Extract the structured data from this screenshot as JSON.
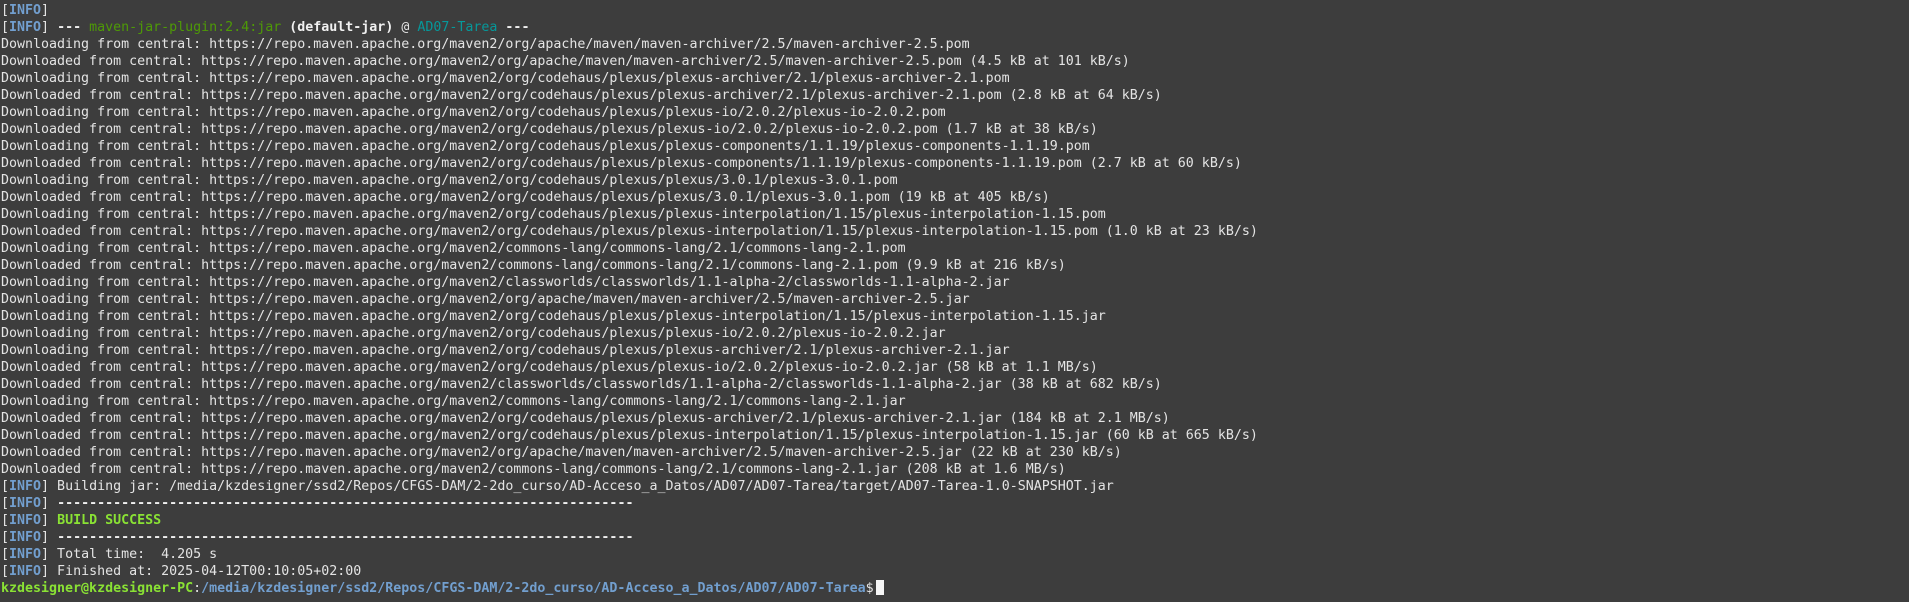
{
  "terminal": {
    "lines": [
      [
        {
          "t": "[",
          "c": ""
        },
        {
          "t": "INFO",
          "c": "info"
        },
        {
          "t": "]",
          "c": ""
        }
      ],
      [
        {
          "t": "[",
          "c": ""
        },
        {
          "t": "INFO",
          "c": "info"
        },
        {
          "t": "] ",
          "c": ""
        },
        {
          "t": "--- ",
          "c": "bold"
        },
        {
          "t": "maven-jar-plugin:2.4:jar",
          "c": "plugin"
        },
        {
          "t": " ",
          "c": ""
        },
        {
          "t": "(default-jar)",
          "c": "bold"
        },
        {
          "t": " @ ",
          "c": ""
        },
        {
          "t": "AD07-Tarea",
          "c": "project"
        },
        {
          "t": " ---",
          "c": "bold"
        }
      ],
      [
        {
          "t": "Downloading from central: https://repo.maven.apache.org/maven2/org/apache/maven/maven-archiver/2.5/maven-archiver-2.5.pom",
          "c": ""
        }
      ],
      [
        {
          "t": "Downloaded from central: https://repo.maven.apache.org/maven2/org/apache/maven/maven-archiver/2.5/maven-archiver-2.5.pom (4.5 kB at 101 kB/s)",
          "c": ""
        }
      ],
      [
        {
          "t": "Downloading from central: https://repo.maven.apache.org/maven2/org/codehaus/plexus/plexus-archiver/2.1/plexus-archiver-2.1.pom",
          "c": ""
        }
      ],
      [
        {
          "t": "Downloaded from central: https://repo.maven.apache.org/maven2/org/codehaus/plexus/plexus-archiver/2.1/plexus-archiver-2.1.pom (2.8 kB at 64 kB/s)",
          "c": ""
        }
      ],
      [
        {
          "t": "Downloading from central: https://repo.maven.apache.org/maven2/org/codehaus/plexus/plexus-io/2.0.2/plexus-io-2.0.2.pom",
          "c": ""
        }
      ],
      [
        {
          "t": "Downloaded from central: https://repo.maven.apache.org/maven2/org/codehaus/plexus/plexus-io/2.0.2/plexus-io-2.0.2.pom (1.7 kB at 38 kB/s)",
          "c": ""
        }
      ],
      [
        {
          "t": "Downloading from central: https://repo.maven.apache.org/maven2/org/codehaus/plexus/plexus-components/1.1.19/plexus-components-1.1.19.pom",
          "c": ""
        }
      ],
      [
        {
          "t": "Downloaded from central: https://repo.maven.apache.org/maven2/org/codehaus/plexus/plexus-components/1.1.19/plexus-components-1.1.19.pom (2.7 kB at 60 kB/s)",
          "c": ""
        }
      ],
      [
        {
          "t": "Downloading from central: https://repo.maven.apache.org/maven2/org/codehaus/plexus/plexus/3.0.1/plexus-3.0.1.pom",
          "c": ""
        }
      ],
      [
        {
          "t": "Downloaded from central: https://repo.maven.apache.org/maven2/org/codehaus/plexus/plexus/3.0.1/plexus-3.0.1.pom (19 kB at 405 kB/s)",
          "c": ""
        }
      ],
      [
        {
          "t": "Downloading from central: https://repo.maven.apache.org/maven2/org/codehaus/plexus/plexus-interpolation/1.15/plexus-interpolation-1.15.pom",
          "c": ""
        }
      ],
      [
        {
          "t": "Downloaded from central: https://repo.maven.apache.org/maven2/org/codehaus/plexus/plexus-interpolation/1.15/plexus-interpolation-1.15.pom (1.0 kB at 23 kB/s)",
          "c": ""
        }
      ],
      [
        {
          "t": "Downloading from central: https://repo.maven.apache.org/maven2/commons-lang/commons-lang/2.1/commons-lang-2.1.pom",
          "c": ""
        }
      ],
      [
        {
          "t": "Downloaded from central: https://repo.maven.apache.org/maven2/commons-lang/commons-lang/2.1/commons-lang-2.1.pom (9.9 kB at 216 kB/s)",
          "c": ""
        }
      ],
      [
        {
          "t": "Downloading from central: https://repo.maven.apache.org/maven2/classworlds/classworlds/1.1-alpha-2/classworlds-1.1-alpha-2.jar",
          "c": ""
        }
      ],
      [
        {
          "t": "Downloading from central: https://repo.maven.apache.org/maven2/org/apache/maven/maven-archiver/2.5/maven-archiver-2.5.jar",
          "c": ""
        }
      ],
      [
        {
          "t": "Downloading from central: https://repo.maven.apache.org/maven2/org/codehaus/plexus/plexus-interpolation/1.15/plexus-interpolation-1.15.jar",
          "c": ""
        }
      ],
      [
        {
          "t": "Downloading from central: https://repo.maven.apache.org/maven2/org/codehaus/plexus/plexus-io/2.0.2/plexus-io-2.0.2.jar",
          "c": ""
        }
      ],
      [
        {
          "t": "Downloading from central: https://repo.maven.apache.org/maven2/org/codehaus/plexus/plexus-archiver/2.1/plexus-archiver-2.1.jar",
          "c": ""
        }
      ],
      [
        {
          "t": "Downloaded from central: https://repo.maven.apache.org/maven2/org/codehaus/plexus/plexus-io/2.0.2/plexus-io-2.0.2.jar (58 kB at 1.1 MB/s)",
          "c": ""
        }
      ],
      [
        {
          "t": "Downloaded from central: https://repo.maven.apache.org/maven2/classworlds/classworlds/1.1-alpha-2/classworlds-1.1-alpha-2.jar (38 kB at 682 kB/s)",
          "c": ""
        }
      ],
      [
        {
          "t": "Downloading from central: https://repo.maven.apache.org/maven2/commons-lang/commons-lang/2.1/commons-lang-2.1.jar",
          "c": ""
        }
      ],
      [
        {
          "t": "Downloaded from central: https://repo.maven.apache.org/maven2/org/codehaus/plexus/plexus-archiver/2.1/plexus-archiver-2.1.jar (184 kB at 2.1 MB/s)",
          "c": ""
        }
      ],
      [
        {
          "t": "Downloaded from central: https://repo.maven.apache.org/maven2/org/codehaus/plexus/plexus-interpolation/1.15/plexus-interpolation-1.15.jar (60 kB at 665 kB/s)",
          "c": ""
        }
      ],
      [
        {
          "t": "Downloaded from central: https://repo.maven.apache.org/maven2/org/apache/maven/maven-archiver/2.5/maven-archiver-2.5.jar (22 kB at 230 kB/s)",
          "c": ""
        }
      ],
      [
        {
          "t": "Downloaded from central: https://repo.maven.apache.org/maven2/commons-lang/commons-lang/2.1/commons-lang-2.1.jar (208 kB at 1.6 MB/s)",
          "c": ""
        }
      ],
      [
        {
          "t": "[",
          "c": ""
        },
        {
          "t": "INFO",
          "c": "info"
        },
        {
          "t": "] Building jar: /media/kzdesigner/ssd2/Repos/CFGS-DAM/2-2do_curso/AD-Acceso_a_Datos/AD07/AD07-Tarea/target/AD07-Tarea-1.0-SNAPSHOT.jar",
          "c": ""
        }
      ],
      [
        {
          "t": "[",
          "c": ""
        },
        {
          "t": "INFO",
          "c": "info"
        },
        {
          "t": "] ",
          "c": ""
        },
        {
          "t": "------------------------------------------------------------------------",
          "c": "bold"
        }
      ],
      [
        {
          "t": "[",
          "c": ""
        },
        {
          "t": "INFO",
          "c": "info"
        },
        {
          "t": "] ",
          "c": ""
        },
        {
          "t": "BUILD SUCCESS",
          "c": "success"
        }
      ],
      [
        {
          "t": "[",
          "c": ""
        },
        {
          "t": "INFO",
          "c": "info"
        },
        {
          "t": "] ",
          "c": ""
        },
        {
          "t": "------------------------------------------------------------------------",
          "c": "bold"
        }
      ],
      [
        {
          "t": "[",
          "c": ""
        },
        {
          "t": "INFO",
          "c": "info"
        },
        {
          "t": "] Total time:  4.205 s",
          "c": ""
        }
      ],
      [
        {
          "t": "[",
          "c": ""
        },
        {
          "t": "INFO",
          "c": "info"
        },
        {
          "t": "] Finished at: 2025-04-12T00:10:05+02:00",
          "c": ""
        }
      ]
    ],
    "prompt": {
      "user_host": "kzdesigner@kzdesigner-PC",
      "separator": ":",
      "path": "/media/kzdesigner/ssd2/Repos/CFGS-DAM/2-2do_curso/AD-Acceso_a_Datos/AD07/AD07-Tarea",
      "symbol": "$",
      "input": ""
    }
  },
  "colors": {
    "background": "#3d3d3d",
    "foreground": "#e4e4e4",
    "info": "#729fcf",
    "plugin": "#4e9a06",
    "project": "#06989a",
    "success": "#8ae234"
  }
}
